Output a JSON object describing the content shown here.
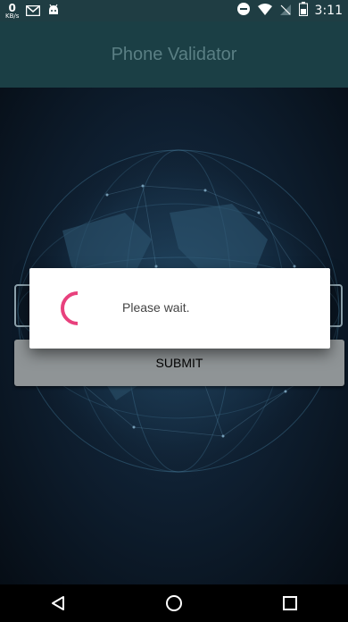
{
  "status_bar": {
    "net_speed": "0",
    "net_unit": "KB/s",
    "time": "3:11",
    "icons": [
      "gmail-icon",
      "android-icon",
      "do-not-disturb-icon",
      "wifi-icon",
      "no-signal-icon",
      "battery-icon"
    ]
  },
  "app_bar": {
    "title": "Phone Validator"
  },
  "form": {
    "phone_input_value": "",
    "submit_label": "SUBMIT"
  },
  "dialog": {
    "message": "Please wait.",
    "spinner_color": "#e8417d"
  },
  "nav_bar": {
    "icons": [
      "back-icon",
      "home-icon",
      "recents-icon"
    ]
  },
  "colors": {
    "app_bar": "#1b3f45",
    "status_bar": "#1f3d43",
    "submit_bg": "#8f9496"
  }
}
